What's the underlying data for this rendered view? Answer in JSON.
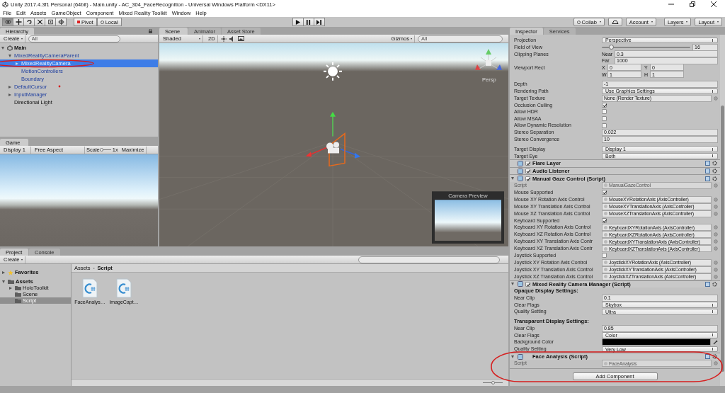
{
  "window": {
    "title": "Unity 2017.4.3f1 Personal (64bit) - Main.unity - AC_304_FaceRecognition - Universal Windows Platform <DX11>"
  },
  "menu": [
    "File",
    "Edit",
    "Assets",
    "GameObject",
    "Component",
    "Mixed Reality Toolkit",
    "Window",
    "Help"
  ],
  "toolbar": {
    "tools": [
      {
        "kind": "view",
        "selected": true
      },
      {
        "kind": "move",
        "selected": false
      },
      {
        "kind": "rotate",
        "selected": false
      },
      {
        "kind": "scale",
        "selected": false
      },
      {
        "kind": "rect",
        "selected": false
      },
      {
        "kind": "transform",
        "selected": false
      }
    ],
    "pivot": "Pivot",
    "local": "Local",
    "collab": "Collab",
    "account": "Account",
    "layers": "Layers",
    "layout": "Layout"
  },
  "hierarchy": {
    "tab": "Hierarchy",
    "create": "Create",
    "search_placeholder": "All",
    "scene": {
      "name": "Main",
      "expanded": true,
      "children": [
        {
          "name": "MixedRealityCameraParent",
          "prefab": true,
          "selected": false,
          "expanded": true,
          "children": [
            {
              "name": "MixedRealityCamera",
              "prefab": true,
              "selected": true,
              "expanded": false
            },
            {
              "name": "MotionControllers",
              "prefab": true,
              "selected": false
            },
            {
              "name": "Boundary",
              "prefab": true,
              "selected": false
            }
          ]
        },
        {
          "name": "DefaultCursor",
          "prefab": true,
          "selected": false,
          "expanded": false
        },
        {
          "name": "InputManager",
          "prefab": true,
          "selected": false,
          "expanded": false
        },
        {
          "name": "Directional Light",
          "prefab": false,
          "selected": false
        }
      ]
    }
  },
  "game": {
    "tab": "Game",
    "display": "Display 1",
    "aspect": "Free Aspect",
    "scale_label": "Scale",
    "level": 0,
    "scale": "1x",
    "maximize": "Maximize"
  },
  "scene": {
    "tabs": [
      {
        "label": "Scene",
        "selected": true
      },
      {
        "label": "Animator",
        "selected": false
      },
      {
        "label": "Asset Store",
        "selected": false
      }
    ],
    "shading": "Shaded",
    "mode_2d": "2D",
    "gizmos": "Gizmos",
    "search_placeholder": "All",
    "view_label": "Persp",
    "camera_preview": "Camera Preview"
  },
  "project": {
    "tabs": [
      {
        "label": "Project",
        "selected": true
      },
      {
        "label": "Console",
        "selected": false
      }
    ],
    "create": "Create",
    "tree": [
      {
        "name": "Favorites",
        "kind": "favorites",
        "selected": false,
        "expanded": false
      },
      {
        "name": "Assets",
        "kind": "folder",
        "selected": false,
        "expanded": true,
        "children": [
          {
            "name": "HoloToolkit",
            "kind": "folder",
            "selected": false,
            "expanded": false
          },
          {
            "name": "Scene",
            "kind": "folder",
            "selected": false
          },
          {
            "name": "Script",
            "kind": "folder",
            "selected": true
          }
        ]
      }
    ],
    "breadcrumb": [
      "Assets",
      "Script"
    ],
    "files": [
      {
        "name": "FaceAnalys…"
      },
      {
        "name": "ImageCapt…"
      }
    ],
    "level": 0.5
  },
  "inspector": {
    "tabs": [
      {
        "label": "Inspector",
        "selected": true
      },
      {
        "label": "Services",
        "selected": false
      }
    ],
    "rows": [
      {
        "kind": "dropdown",
        "label": "Projection",
        "value": "Perspective"
      },
      {
        "kind": "slider",
        "label": "Field of View",
        "level": 0.1,
        "value": "16"
      },
      {
        "kind": "clip",
        "label": "Clipping Planes",
        "near_label": "Near",
        "near": "0.3",
        "far_label": "Far",
        "far": "1000"
      },
      {
        "kind": "rect",
        "label": "Viewport Rect",
        "fields": [
          {
            "key": "X",
            "value": "0"
          },
          {
            "key": "Y",
            "value": "0"
          },
          {
            "key": "W",
            "value": "1"
          },
          {
            "key": "H",
            "value": "1"
          }
        ]
      },
      {
        "kind": "gap"
      },
      {
        "kind": "text",
        "label": "Depth",
        "value": "-1"
      },
      {
        "kind": "dropdown",
        "label": "Rendering Path",
        "value": "Use Graphics Settings"
      },
      {
        "kind": "object",
        "label": "Target Texture",
        "value": "None (Render Texture)",
        "disabled": false,
        "icon": false
      },
      {
        "kind": "checkbox",
        "label": "Occlusion Culling",
        "checked": true
      },
      {
        "kind": "checkbox",
        "label": "Allow HDR",
        "checked": false
      },
      {
        "kind": "checkbox",
        "label": "Allow MSAA",
        "checked": false
      },
      {
        "kind": "checkbox",
        "label": "Allow Dynamic Resolution",
        "checked": false
      },
      {
        "kind": "text",
        "label": "Stereo Separation",
        "value": "0.022"
      },
      {
        "kind": "text",
        "label": "Stereo Convergence",
        "value": "10"
      },
      {
        "kind": "gap"
      },
      {
        "kind": "dropdown",
        "label": "Target Display",
        "value": "Display 1"
      },
      {
        "kind": "dropdown",
        "label": "Target Eye",
        "value": "Both"
      },
      {
        "kind": "component",
        "title": "Flare Layer",
        "enabled": true
      },
      {
        "kind": "component",
        "title": "Audio Listener",
        "enabled": true
      },
      {
        "kind": "component",
        "title": "Manual Gaze Control (Script)",
        "enabled": true,
        "expanded": true
      },
      {
        "kind": "object",
        "label": "Script",
        "value": "ManualGazeControl",
        "disabled": true,
        "icon": true
      },
      {
        "kind": "checkbox",
        "label": "Mouse Supported",
        "checked": true
      },
      {
        "kind": "object",
        "label": "Mouse XY Rotation Axis Control",
        "value": "MouseXYRotationAxis (AxisController)",
        "disabled": false,
        "icon": true
      },
      {
        "kind": "object",
        "label": "Mouse XY Translation Axis Control",
        "value": "MouseXYTranslationAxis (AxisController)",
        "disabled": false,
        "icon": true
      },
      {
        "kind": "object",
        "label": "Mouse XZ Translation Axis Control",
        "value": "MouseXZTranslationAxis (AxisController)",
        "disabled": false,
        "icon": true
      },
      {
        "kind": "checkbox",
        "label": "Keyboard Supported",
        "checked": true
      },
      {
        "kind": "object",
        "label": "Keyboard XY Rotation Axis Control",
        "value": "KeyboardXYRotationAxis (AxisController)",
        "disabled": false,
        "icon": true
      },
      {
        "kind": "object",
        "label": "Keyboard XZ Rotation Axis Control",
        "value": "KeyboardXZRotationAxis (AxisController)",
        "disabled": false,
        "icon": true
      },
      {
        "kind": "object",
        "label": "Keyboard XY Translation Axis Contr",
        "value": "KeyboardXYTranslationAxis (AxisController)",
        "disabled": false,
        "icon": true
      },
      {
        "kind": "object",
        "label": "Keyboard XZ Translation Axis Contr",
        "value": "KeyboardXZTranslationAxis (AxisController)",
        "disabled": false,
        "icon": true
      },
      {
        "kind": "checkbox",
        "label": "Joystick Supported",
        "checked": false
      },
      {
        "kind": "object",
        "label": "Joystick XY Rotation Axis Control",
        "value": "JoystickXYRotationAxis (AxisController)",
        "disabled": false,
        "icon": true
      },
      {
        "kind": "object",
        "label": "Joystick XY Translation Axis Control",
        "value": "JoystickXYTranslationAxis (AxisController)",
        "disabled": false,
        "icon": true
      },
      {
        "kind": "object",
        "label": "Joystick XZ Translation Axis Control",
        "value": "JoystickXZTranslationAxis (AxisController)",
        "disabled": false,
        "icon": true
      },
      {
        "kind": "component",
        "title": "Mixed Reality Camera Manager (Script)",
        "enabled": true,
        "expanded": true
      },
      {
        "kind": "section",
        "label": "Opaque Display Settings:"
      },
      {
        "kind": "text",
        "label": "Near Clip",
        "value": "0.1"
      },
      {
        "kind": "dropdown",
        "label": "Clear Flags",
        "value": "Skybox"
      },
      {
        "kind": "dropdown",
        "label": "Quality Setting",
        "value": "Ultra"
      },
      {
        "kind": "gap"
      },
      {
        "kind": "section",
        "label": "Transparent Display Settings:"
      },
      {
        "kind": "text",
        "label": "Near Clip",
        "value": "0.85"
      },
      {
        "kind": "dropdown",
        "label": "Clear Flags",
        "value": "Color"
      },
      {
        "kind": "color",
        "label": "Background Color",
        "color": "#000000"
      },
      {
        "kind": "dropdown",
        "label": "Quality Setting",
        "value": "Very Low"
      },
      {
        "kind": "component",
        "title": "Face Analysis (Script)",
        "expanded": true
      },
      {
        "kind": "object",
        "label": "Script",
        "value": "FaceAnalysis",
        "disabled": true,
        "icon": true
      }
    ],
    "add_button": "Add Component"
  }
}
